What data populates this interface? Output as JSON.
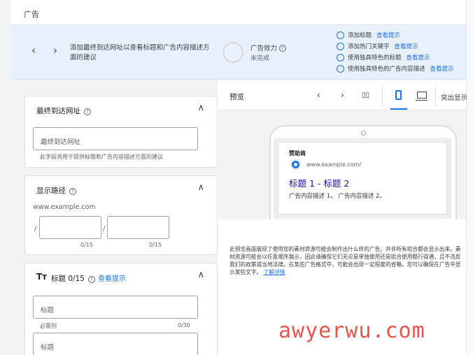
{
  "page": {
    "title": "广告"
  },
  "banner": {
    "prev": "‹",
    "next": "›",
    "message": "添加最终到达网址以查看标题和广告内容描述方面的建议",
    "strength_label": "广告效力",
    "strength_help": "?",
    "strength_status": "未完成",
    "tips": [
      {
        "text": "添加标题",
        "link": "查看提示"
      },
      {
        "text": "添加热门关键字",
        "link": "查看提示"
      },
      {
        "text": "使用独具特色的标题",
        "link": "查看提示"
      },
      {
        "text": "使用独具特色的广告内容描述",
        "link": "查看提示"
      }
    ]
  },
  "final_url": {
    "title": "最终到达网址",
    "help": "?",
    "chevron": "∧",
    "placeholder": "最终到达网址",
    "helper": "此字段将用于提供标题和广告内容描述方面的建议"
  },
  "display_path": {
    "title": "显示路径",
    "help": "?",
    "chevron": "∧",
    "domain": "www.example.com",
    "slash": "/",
    "counter1": "0/15",
    "counter2": "0/15"
  },
  "headlines": {
    "icon": "Tт",
    "title": "标题 0/15",
    "help": "?",
    "link": "查看提示",
    "chevron": "∧",
    "field1_placeholder": "标题",
    "required": "必需列",
    "counter1": "0/30",
    "field2_placeholder": "标题"
  },
  "preview": {
    "label": "预览",
    "prev": "‹",
    "next": "›",
    "columns_icon": "▯▯",
    "highlight_label": "突出显示",
    "ad": {
      "sponsor": "赞助商",
      "url": "www.example.com/",
      "headline": "标题 1 - 标题 2",
      "description": "广告内容描述 1。 广告内容描述 2。"
    },
    "disclaimer": "此预览画面展现了使用您的素材资源可能会制作出什么样的广告。并非所有组合都会显示出来。素材资源可能会以任意顺序展示，因此请确保它们无论是单独使用还是组合使用都行得通，且不违反我们的政策或当地法律。在某些广告格式中，可能会出现一定程度的省略。您可以确保在广告中显示某些文字。",
    "disclaimer_link": "了解详情"
  },
  "watermark": "awyerwu.com",
  "colors": {
    "accent": "#1a73e8",
    "banner_bg": "#e8f0fe",
    "panel_bg": "#f1f3f4",
    "watermark": "#e4463f"
  }
}
